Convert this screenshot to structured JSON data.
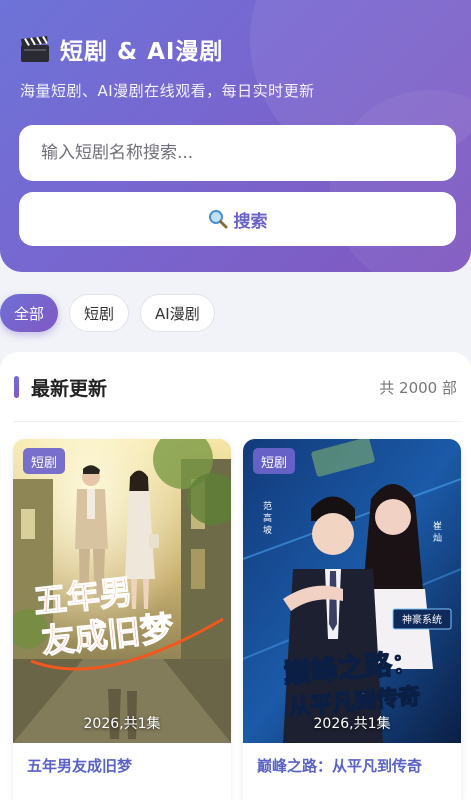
{
  "header": {
    "title": "短剧 & AI漫剧",
    "subtitle": "海量短剧、AI漫剧在线观看，每日实时更新",
    "icon": "clapperboard-icon"
  },
  "search": {
    "placeholder": "输入短剧名称搜索...",
    "button_label": "搜索",
    "button_icon": "search-icon"
  },
  "filters": [
    {
      "label": "全部",
      "active": true
    },
    {
      "label": "短剧",
      "active": false
    },
    {
      "label": "AI漫剧",
      "active": false
    }
  ],
  "section": {
    "title": "最新更新",
    "count": "共 2000 部"
  },
  "cards": [
    {
      "badge": "短剧",
      "poster_title": "五年男友成旧梦",
      "meta": "2026,共1集",
      "title": "五年男友成旧梦"
    },
    {
      "badge": "短剧",
      "poster_title_line1": "巅峰之路：",
      "poster_title_line2": "从平凡到传奇",
      "poster_tag": "神豪系统",
      "meta": "2026,共1集",
      "title": "巅峰之路：从平凡到传奇"
    }
  ],
  "colors": {
    "header_gradient_start": "#6d73d8",
    "header_gradient_end": "#8058bf",
    "accent": "#6a62c9",
    "card_title": "#5a62c8"
  }
}
